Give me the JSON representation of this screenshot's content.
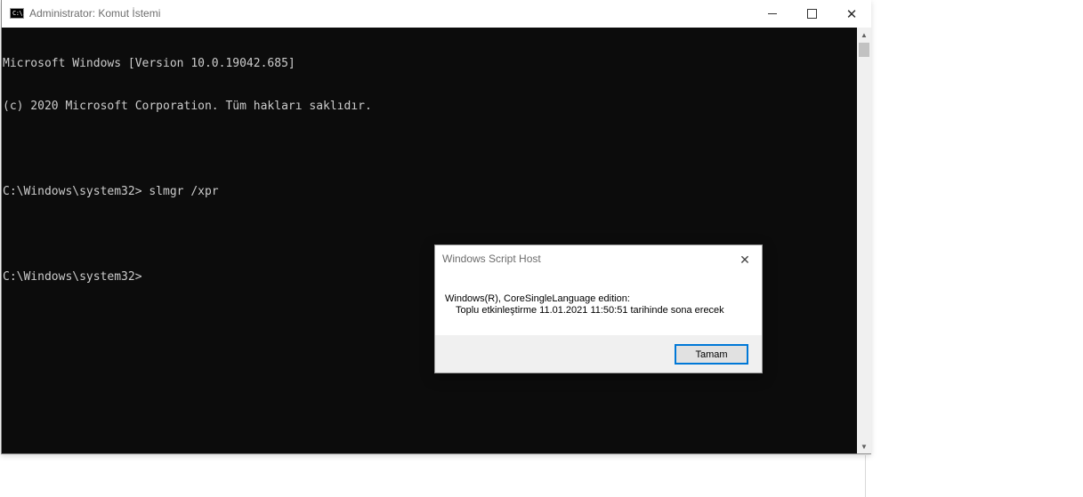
{
  "window": {
    "title": "Administrator: Komut İstemi",
    "icon_label": "C:\\."
  },
  "terminal": {
    "lines": [
      "Microsoft Windows [Version 10.0.19042.685]",
      "(c) 2020 Microsoft Corporation. Tüm hakları saklıdır.",
      "",
      "C:\\Windows\\system32> slmgr /xpr",
      "",
      "C:\\Windows\\system32>"
    ]
  },
  "dialog": {
    "title": "Windows Script Host",
    "message_line1": "Windows(R), CoreSingleLanguage edition:",
    "message_line2": "Toplu etkinleştirme 11.01.2021 11:50:51 tarihinde sona erecek",
    "ok_label": "Tamam"
  },
  "icons": {
    "close": "✕",
    "scroll_up": "▲",
    "scroll_down": "▼"
  },
  "colors": {
    "terminal_bg": "#0c0c0c",
    "terminal_fg": "#cccccc",
    "accent": "#0078d7"
  }
}
